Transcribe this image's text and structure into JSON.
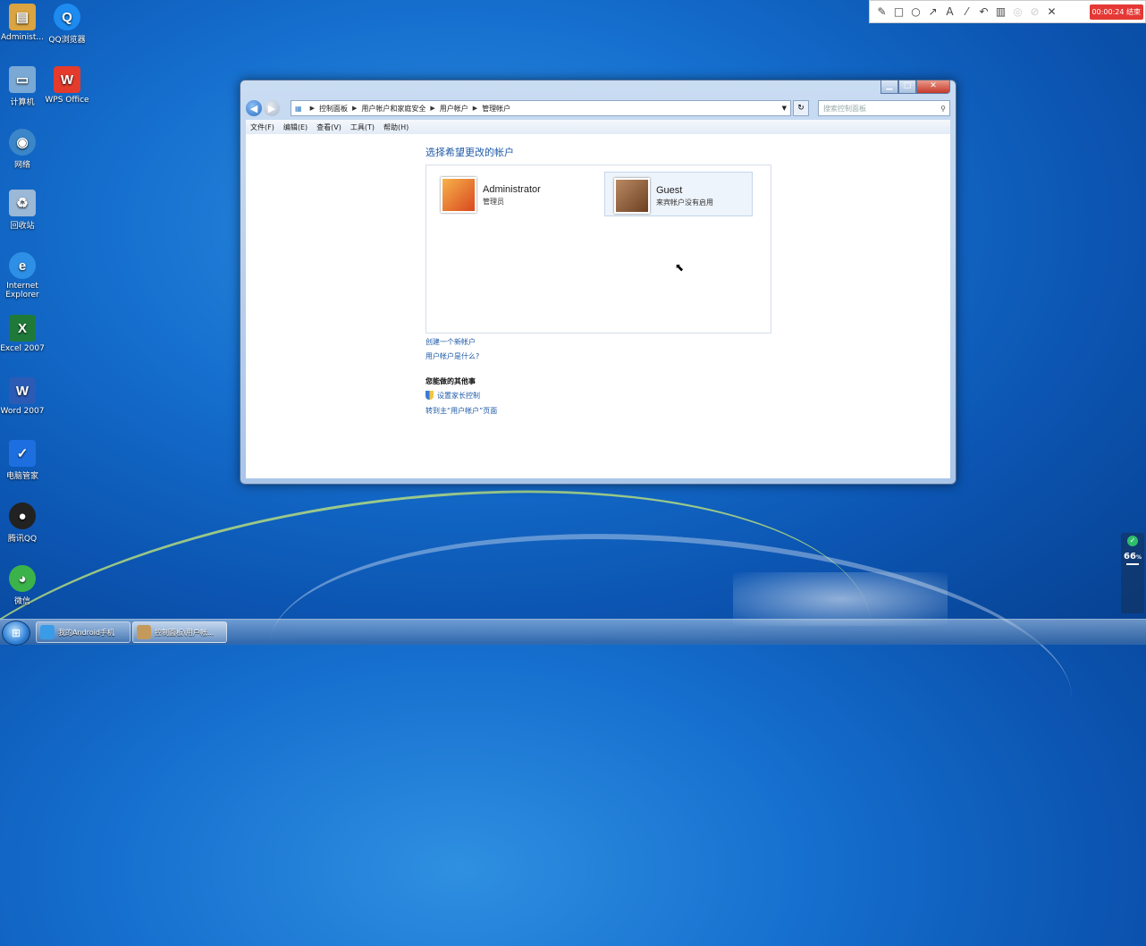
{
  "desktop_icons": [
    {
      "label": "Administ...",
      "icon": "folder-icon",
      "color": "#d9a441"
    },
    {
      "label": "QQ浏览器",
      "icon": "qq-browser-icon",
      "color": "#1d8bf0"
    },
    {
      "label": "计算机",
      "icon": "computer-icon",
      "color": "#7aa9d6"
    },
    {
      "label": "WPS Office",
      "icon": "wps-office-icon",
      "color": "#e43b2c"
    },
    {
      "label": "网络",
      "icon": "network-icon",
      "color": "#3a86c8"
    },
    {
      "label": "回收站",
      "icon": "recycle-bin-icon",
      "color": "#9bb8d6"
    },
    {
      "label": "Internet Explorer",
      "icon": "internet-explorer-icon",
      "color": "#2d8fe5"
    },
    {
      "label": "Excel 2007",
      "icon": "excel-icon",
      "color": "#1f7a3a"
    },
    {
      "label": "Word 2007",
      "icon": "word-icon",
      "color": "#2b5bb5"
    },
    {
      "label": "电脑管家",
      "icon": "pc-manager-icon",
      "color": "#1d6fe0"
    },
    {
      "label": "腾讯QQ",
      "icon": "qq-icon",
      "color": "#222222"
    },
    {
      "label": "微信",
      "icon": "wechat-icon",
      "color": "#3bb34a"
    }
  ],
  "recorder": {
    "timer": "00:00:24 结束"
  },
  "window": {
    "breadcrumb": [
      "控制面板",
      "用户帐户和家庭安全",
      "用户帐户",
      "管理帐户"
    ],
    "search_placeholder": "搜索控制面板",
    "menu": [
      "文件(F)",
      "编辑(E)",
      "查看(V)",
      "工具(T)",
      "帮助(H)"
    ],
    "heading": "选择希望更改的帐户",
    "accounts": [
      {
        "name": "Administrator",
        "role": "管理员",
        "pic_color": "#e8712a"
      },
      {
        "name": "Guest",
        "role": "来宾帐户没有启用",
        "pic_color": "#8a5a3c"
      }
    ],
    "links": {
      "create": "创建一个新帐户",
      "what_is": "用户帐户是什么?",
      "other_heading": "您能做的其他事",
      "parental": "设置家长控制",
      "main_page": "转到主“用户帐户”页面"
    }
  },
  "taskbar": {
    "tasks": [
      {
        "label": "我的Android手机",
        "active": false
      },
      {
        "label": "控制面板\\用户帐...",
        "active": true
      }
    ]
  },
  "widget": {
    "value": "66",
    "unit": "%"
  }
}
